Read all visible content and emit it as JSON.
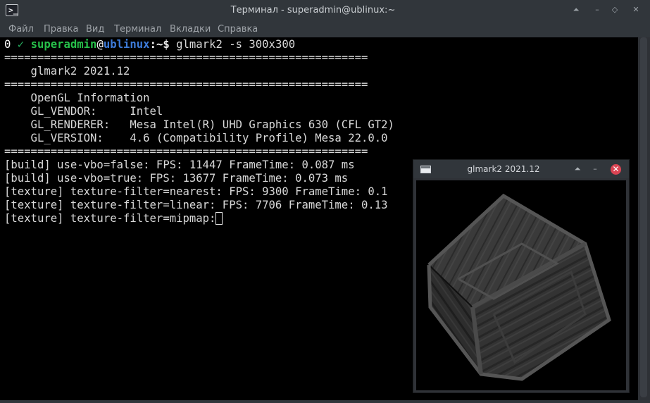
{
  "window": {
    "title": "Терминал - superadmin@ublinux:~",
    "buttons": {
      "keep_above": "⏶",
      "minimize": "–",
      "maximize": "◇",
      "close": "✕"
    }
  },
  "menu": [
    "Файл",
    "Правка",
    "Вид",
    "Терминал",
    "Вкладки",
    "Справка"
  ],
  "prompt": {
    "exit_code": "0",
    "check": "✓",
    "user": "superadmin",
    "at": "@",
    "host": "ublinux",
    "path": ":~$",
    "command": " glmark2 -s 300x300"
  },
  "output": {
    "separator": "=======================================================",
    "version_line": "    glmark2 2021.12",
    "info_header": "    OpenGL Information",
    "vendor_line": "    GL_VENDOR:     Intel",
    "renderer_line": "    GL_RENDERER:   Mesa Intel(R) UHD Graphics 630 (CFL GT2)",
    "gl_version_line": "    GL_VERSION:    4.6 (Compatibility Profile) Mesa 22.0.0",
    "results": [
      "[build] use-vbo=false: FPS: 11447 FrameTime: 0.087 ms",
      "[build] use-vbo=true: FPS: 13677 FrameTime: 0.073 ms",
      "[texture] texture-filter=nearest: FPS: 9300 FrameTime: 0.1",
      "[texture] texture-filter=linear: FPS: 7706 FrameTime: 0.13",
      "[texture] texture-filter=mipmap:"
    ]
  },
  "glmark_window": {
    "title": "glmark2 2021.12",
    "buttons": {
      "keep_above": "⏶",
      "minimize": "–",
      "close": "✕"
    }
  },
  "colors": {
    "terminal_bg": "#000000",
    "user": "#27c04a",
    "host": "#3d7bd9",
    "close_button": "#da4453",
    "chrome": "#31363b"
  },
  "icons": [
    "terminal-icon",
    "window-icon",
    "crate-cube-render"
  ]
}
